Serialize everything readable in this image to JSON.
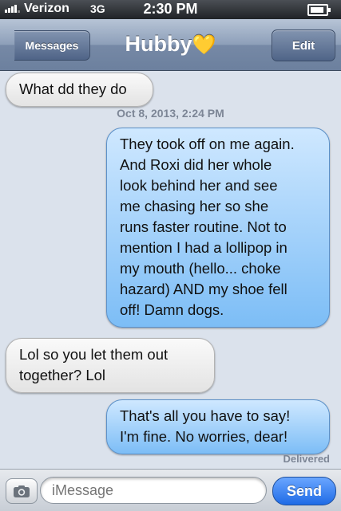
{
  "status_bar": {
    "carrier": "Verizon",
    "network": "3G",
    "time": "2:30 PM",
    "signal_bars": 4,
    "icons": [
      "signal-icon",
      "battery-icon"
    ]
  },
  "nav": {
    "back_label": "Messages",
    "title": "Hubby",
    "title_icon": "yellow-heart",
    "edit_label": "Edit"
  },
  "conversation": {
    "timestamp": "Oct 8, 2013, 2:24 PM",
    "messages": [
      {
        "direction": "incoming",
        "lines": [
          "What dd they do"
        ]
      },
      {
        "direction": "outgoing",
        "lines": [
          "They took off on me again.",
          "And Roxi did her whole",
          "look behind her and see",
          "me chasing her so she",
          "runs faster routine. Not to",
          "mention I had a lollipop in",
          "my mouth (hello... choke",
          "hazard) AND my shoe fell",
          "off! Damn dogs."
        ]
      },
      {
        "direction": "incoming",
        "lines": [
          "Lol so you let them out",
          "together? Lol"
        ]
      },
      {
        "direction": "outgoing",
        "lines": [
          "That's all you have to say!",
          "I'm fine. No worries, dear!"
        ]
      }
    ],
    "delivered_label": "Delivered"
  },
  "input": {
    "placeholder": "iMessage",
    "send_label": "Send",
    "camera_icon": "camera-icon"
  },
  "colors": {
    "incoming_bubble": "#e8e8e8",
    "outgoing_bubble": "#8ec8fb",
    "nav_bar": "#7b8eab",
    "send_button": "#2a74ea",
    "heart": "#ffd84a"
  }
}
